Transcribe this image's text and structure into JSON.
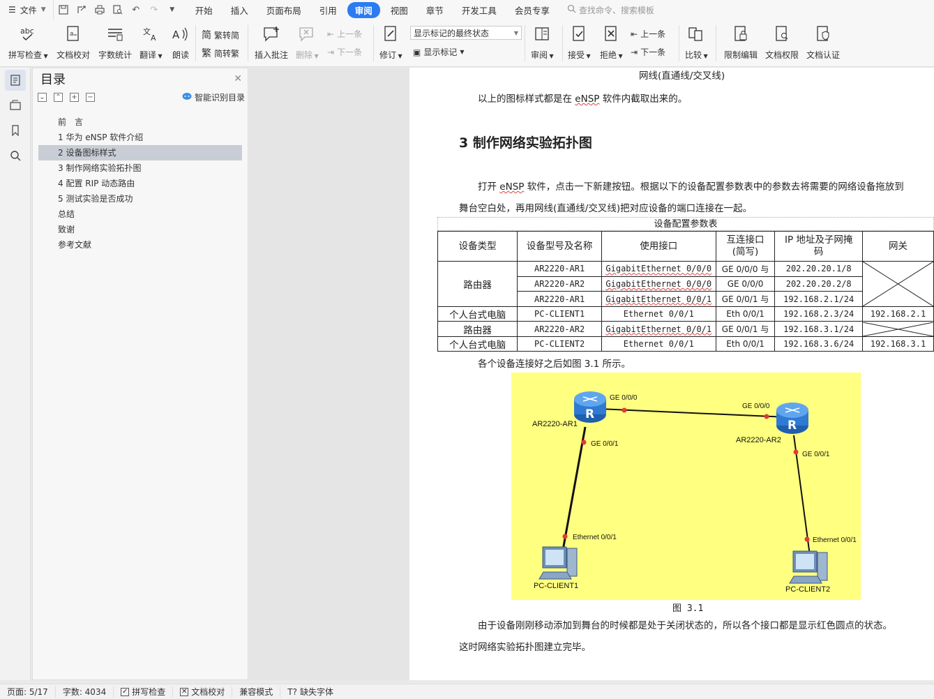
{
  "menubar": {
    "file_label": "文件",
    "tabs": [
      "开始",
      "插入",
      "页面布局",
      "引用",
      "审阅",
      "视图",
      "章节",
      "开发工具",
      "会员专享"
    ],
    "active_tab": "审阅",
    "search_placeholder": "查找命令、搜索模板"
  },
  "ribbon": {
    "spell_check": "拼写检查",
    "doc_proof": "文档校对",
    "word_count": "字数统计",
    "translate": "翻译",
    "read_aloud": "朗读",
    "trad_to_simp": "繁转简",
    "simp_to_trad": "简转繁",
    "insert_comment": "插入批注",
    "delete": "删除",
    "prev": "上一条",
    "next": "下一条",
    "track": "修订",
    "markup_select": "显示标记的最终状态",
    "show_markup": "显示标记",
    "review": "审阅",
    "accept": "接受",
    "reject": "拒绝",
    "prev2": "上一条",
    "next2": "下一条",
    "compare": "比较",
    "restrict_edit": "限制编辑",
    "doc_permission": "文档权限",
    "doc_cert": "文档认证"
  },
  "toc": {
    "title": "目录",
    "smart_label": "智能识别目录",
    "items": [
      "前　言",
      "1 华为 eNSP 软件介绍",
      "2 设备图标样式",
      "3 制作网络实验拓扑图",
      "4 配置 RIP 动态路由",
      "5 测试实验是否成功",
      "总结",
      "致谢",
      "参考文献"
    ],
    "selected_index": 2
  },
  "doc": {
    "line_top": "网线(直通线/交叉线)",
    "p1_a": "以上的图标样式都是在 ",
    "p1_ensp": "eNSP",
    "p1_b": " 软件内截取出来的。",
    "heading": "3 制作网络实验拓扑图",
    "p2_a": "打开 ",
    "p2_ensp": "eNSP",
    "p2_b": " 软件，点击一下新建按钮。根据以下的设备配置参数表中的参数去将需要的网络设备拖放到",
    "p2_line2": "舞台空白处，再用网线(直通线/交叉线)把对应设备的端口连接在一起。",
    "table_title": "设备配置参数表",
    "headers": [
      "设备类型",
      "设备型号及名称",
      "使用接口",
      "互连接口(简写)",
      "IP 地址及子网掩码",
      "网关"
    ],
    "header_interlink_1": "互连接口",
    "header_interlink_2": "(简写)",
    "header_ip_1": "IP 地址及子网掩",
    "header_ip_2": "码",
    "rows": [
      {
        "type": "路由器",
        "model": "AR2220-AR1",
        "iface": "GigabitEthernet 0/0/0",
        "link": "GE 0/0/0 与",
        "ip": "202.20.20.1/8",
        "gw": ""
      },
      {
        "type": "",
        "model": "AR2220-AR2",
        "iface": "GigabitEthernet 0/0/0",
        "link": "GE 0/0/0",
        "ip": "202.20.20.2/8",
        "gw": ""
      },
      {
        "type": "",
        "model": "AR2220-AR1",
        "iface": "GigabitEthernet 0/0/1",
        "link": "GE 0/0/1 与",
        "ip": "192.168.2.1/24",
        "gw": ""
      },
      {
        "type": "个人台式电脑",
        "model": "PC-CLIENT1",
        "iface": "Ethernet 0/0/1",
        "link": "Eth 0/0/1",
        "ip": "192.168.2.3/24",
        "gw": "192.168.2.1"
      },
      {
        "type": "路由器",
        "model": "AR2220-AR2",
        "iface": "GigabitEthernet 0/0/1",
        "link": "GE 0/0/1 与",
        "ip": "192.168.3.1/24",
        "gw": ""
      },
      {
        "type": "个人台式电脑",
        "model": "PC-CLIENT2",
        "iface": "Ethernet 0/0/1",
        "link": "Eth 0/0/1",
        "ip": "192.168.3.6/24",
        "gw": "192.168.3.1"
      }
    ],
    "p3": "各个设备连接好之后如图 3.1 所示。",
    "figure": {
      "ar1": "AR2220-AR1",
      "ar2": "AR2220-AR2",
      "pc1": "PC-CLIENT1",
      "pc2": "PC-CLIENT2",
      "ar1_ge0": "GE 0/0/0",
      "ar2_ge0": "GE 0/0/0",
      "ar1_ge1": "GE 0/0/1",
      "ar2_ge1": "GE 0/0/1",
      "pc1_eth": "Ethernet 0/0/1",
      "pc2_eth": "Ethernet 0/0/1",
      "router_glyph": "R"
    },
    "caption": "图 3.1",
    "p4": "由于设备刚刚移动添加到舞台的时候都是处于关闭状态的，所以各个接口都是显示红色圆点的状态。",
    "p5": "这时网络实验拓扑图建立完毕。"
  },
  "status": {
    "page": "页面: 5/17",
    "words": "字数: 4034",
    "spell": "拼写检查",
    "proof": "文档校对",
    "compat": "兼容模式",
    "missing_font": "缺失字体"
  },
  "colors": {
    "accent": "#2b7cf2",
    "figure_bg": "#ffff80",
    "port_dot": "#e53935"
  }
}
